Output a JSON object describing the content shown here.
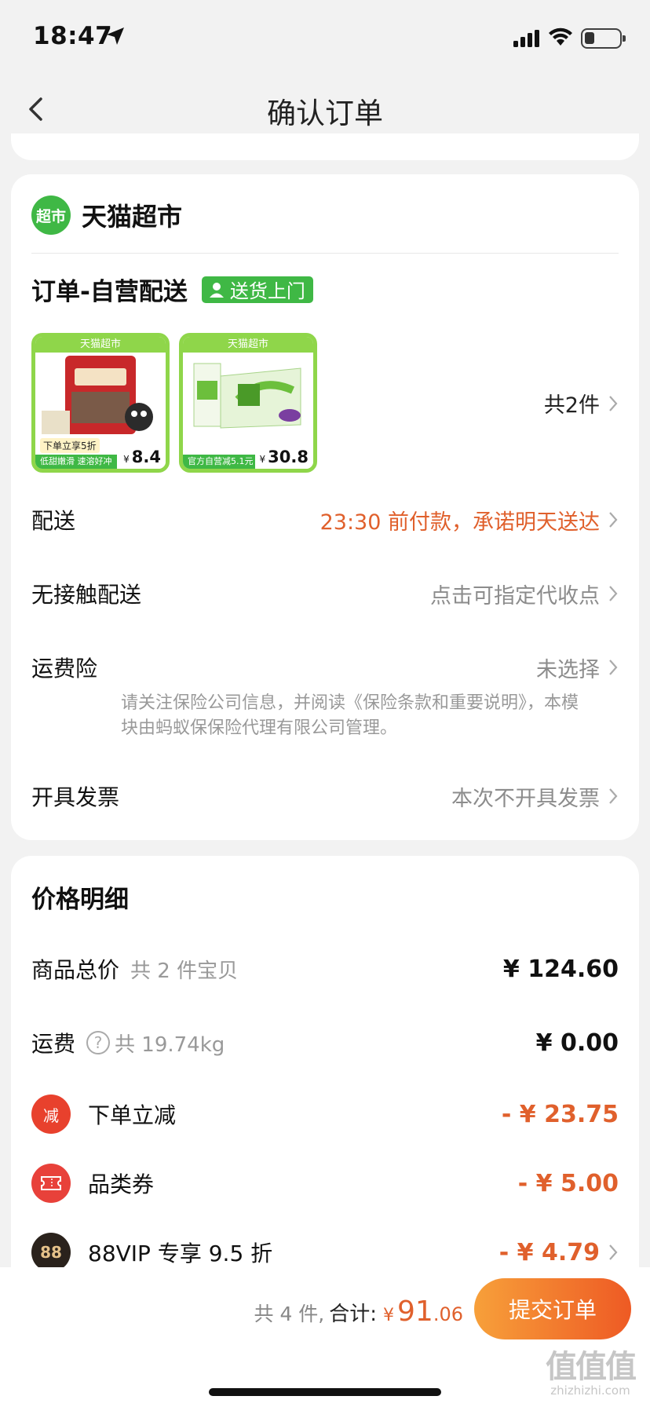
{
  "status_bar": {
    "time": "18:47",
    "icons": [
      "location-arrow-icon",
      "signal-icon",
      "wifi-icon",
      "battery-icon"
    ]
  },
  "nav": {
    "title": "确认订单"
  },
  "store": {
    "logo_text": "超市",
    "name": "天猫超市",
    "order_type": "订单-自营配送",
    "delivery_badge": "送货上门",
    "products": [
      {
        "banner": "天猫超市",
        "promo": "下单立享5折",
        "tag": "低甜嫩滑 速溶好冲",
        "price": "8.4",
        "currency": "¥"
      },
      {
        "banner": "天猫超市",
        "tag": "官方自营减5.1元",
        "price": "30.8",
        "currency": "¥"
      }
    ],
    "item_count": "共2件",
    "rows": {
      "delivery": {
        "label": "配送",
        "value": "23:30 前付款，承诺明天送达"
      },
      "contactless": {
        "label": "无接触配送",
        "value": "点击可指定代收点"
      },
      "insurance": {
        "label": "运费险",
        "value": "未选择",
        "note": "请关注保险公司信息，并阅读《保险条款和重要说明》，本模块由蚂蚁保保险代理有限公司管理。"
      },
      "invoice": {
        "label": "开具发票",
        "value": "本次不开具发票"
      }
    }
  },
  "price_detail": {
    "title": "价格明细",
    "goods_total": {
      "label": "商品总价",
      "sub": "共 2 件宝贝",
      "amount": "¥ 124.60"
    },
    "shipping": {
      "label": "运费",
      "sub": "共 19.74kg",
      "amount": "¥ 0.00"
    },
    "instant_discount": {
      "label": "下单立减",
      "icon_text": "减",
      "amount": "- ¥ 23.75"
    },
    "category_coupon": {
      "label": "品类券",
      "amount": "- ¥ 5.00"
    },
    "vip": {
      "label": "88VIP 专享 9.5 折",
      "icon_text": "88",
      "amount": "- ¥ 4.79"
    }
  },
  "bottom_bar": {
    "count": "共 4 件,",
    "total_label": "合计:",
    "currency": "¥",
    "total_int": "91",
    "total_dec": ".06",
    "submit": "提交订单"
  },
  "watermark": {
    "text": "值值值",
    "sub": "zhizhizhi.com"
  },
  "colors": {
    "accent_orange": "#e0602c",
    "store_green": "#3fb845",
    "submit_gradient_start": "#f7a03a",
    "submit_gradient_end": "#ee5a24"
  }
}
